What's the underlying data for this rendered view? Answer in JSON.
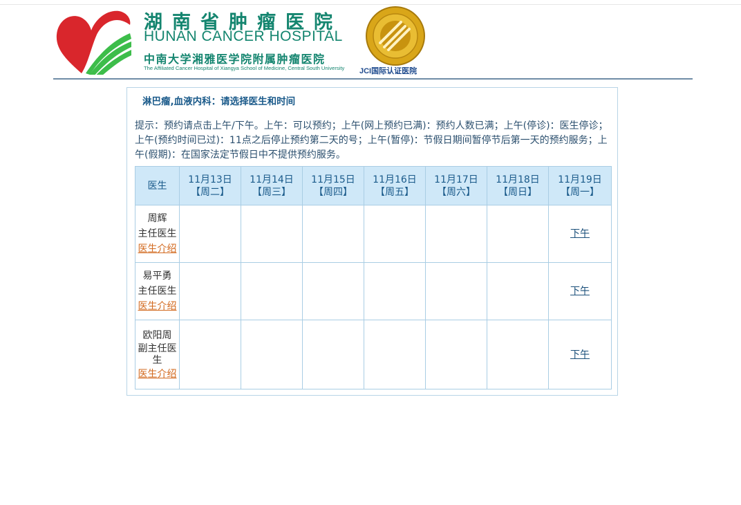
{
  "header": {
    "hospital_name_cn": "湖南省肿瘤医院",
    "hospital_name_en": "HUNAN CANCER HOSPITAL",
    "affiliation_cn": "中南大学湘雅医学院附属肿瘤医院",
    "affiliation_en": "The Affiliated Cancer Hospital of Xiangya School of Medicine, Central South University",
    "seal_caption": "JCI国际认证医院",
    "colors": {
      "brand_green": "#14856f",
      "heart_red": "#d9262c",
      "stripe_green": "#3dbd4a",
      "seal_gold": "#d9a619"
    }
  },
  "panel": {
    "title": "淋巴瘤,血液内科：请选择医生和时间",
    "notice": "提示：预约请点击上午/下午。上午：可以预约；上午(网上预约已满)：预约人数已满；上午(停诊)：医生停诊；上午(预约时间已过)：11点之后停止预约第二天的号；上午(暂停)：节假日期间暂停节后第一天的预约服务；上午(假期)：在国家法定节假日中不提供预约服务。"
  },
  "schedule": {
    "doctor_header": "医生",
    "days": [
      {
        "date": "11月13日",
        "weekday": "【周二】"
      },
      {
        "date": "11月14日",
        "weekday": "【周三】"
      },
      {
        "date": "11月15日",
        "weekday": "【周四】"
      },
      {
        "date": "11月16日",
        "weekday": "【周五】"
      },
      {
        "date": "11月17日",
        "weekday": "【周六】"
      },
      {
        "date": "11月18日",
        "weekday": "【周日】"
      },
      {
        "date": "11月19日",
        "weekday": "【周一】"
      }
    ],
    "doctors": [
      {
        "name": "周辉",
        "title": "主任医生",
        "intro": "医生介绍",
        "slots": [
          "",
          "",
          "",
          "",
          "",
          "",
          "下午"
        ]
      },
      {
        "name": "易平勇",
        "title": "主任医生",
        "intro": "医生介绍",
        "slots": [
          "",
          "",
          "",
          "",
          "",
          "",
          "下午"
        ]
      },
      {
        "name": "欧阳周",
        "title": "副主任医生",
        "intro": "医生介绍",
        "slots": [
          "",
          "",
          "",
          "",
          "",
          "",
          "下午"
        ]
      }
    ]
  }
}
